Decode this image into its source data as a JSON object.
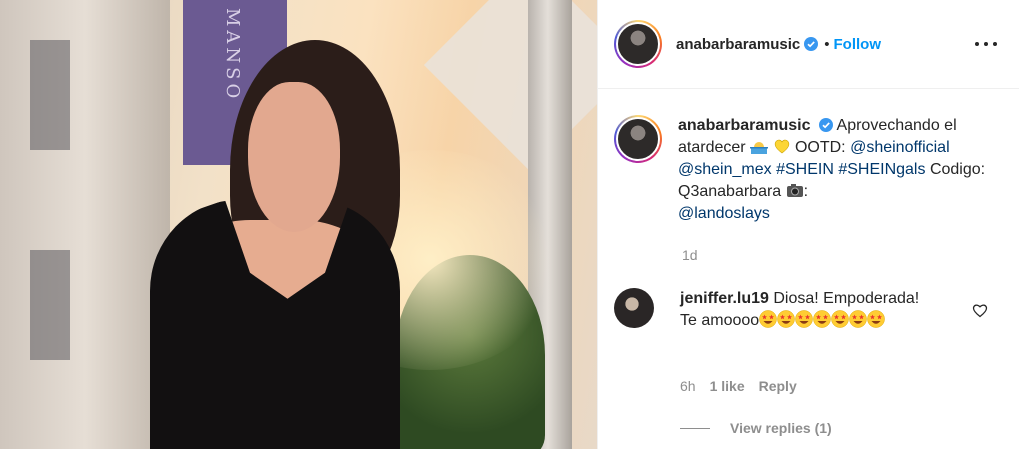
{
  "post": {
    "author": "anabarbaramusic",
    "verified_icon": "verified-badge-icon",
    "separator": "•",
    "follow_label": "Follow",
    "more_icon": "more-options-icon",
    "photo_banner_text": "MANSO"
  },
  "caption": {
    "username": "anabarbaramusic",
    "text_1": "Aprovechando el atardecer",
    "emoji_1": "sunset-emoji",
    "emoji_2": "yellow-heart-emoji",
    "text_2": "OOTD:",
    "mention_1": "@sheinofficial",
    "mention_2": "@shein_mex",
    "hashtag_1": "#SHEIN",
    "hashtag_2": "#SHEINgals",
    "text_3": "Codigo: Q3anabarbara",
    "emoji_3": "camera-emoji",
    "text_4": ":",
    "mention_3": "@landoslays",
    "time": "1d"
  },
  "comment": {
    "username": "jeniffer.lu19",
    "text": "Diosa! Empoderada! Te amoooo",
    "emoji": "star-struck-emoji",
    "emoji_count": 7,
    "time": "6h",
    "likes": "1 like",
    "reply_label": "Reply",
    "heart_icon": "heart-outline-icon",
    "view_replies": "View replies (1)"
  },
  "colors": {
    "link_blue": "#0095f6",
    "mention": "#00376b",
    "muted": "#8e8e8e",
    "text": "#262626"
  }
}
